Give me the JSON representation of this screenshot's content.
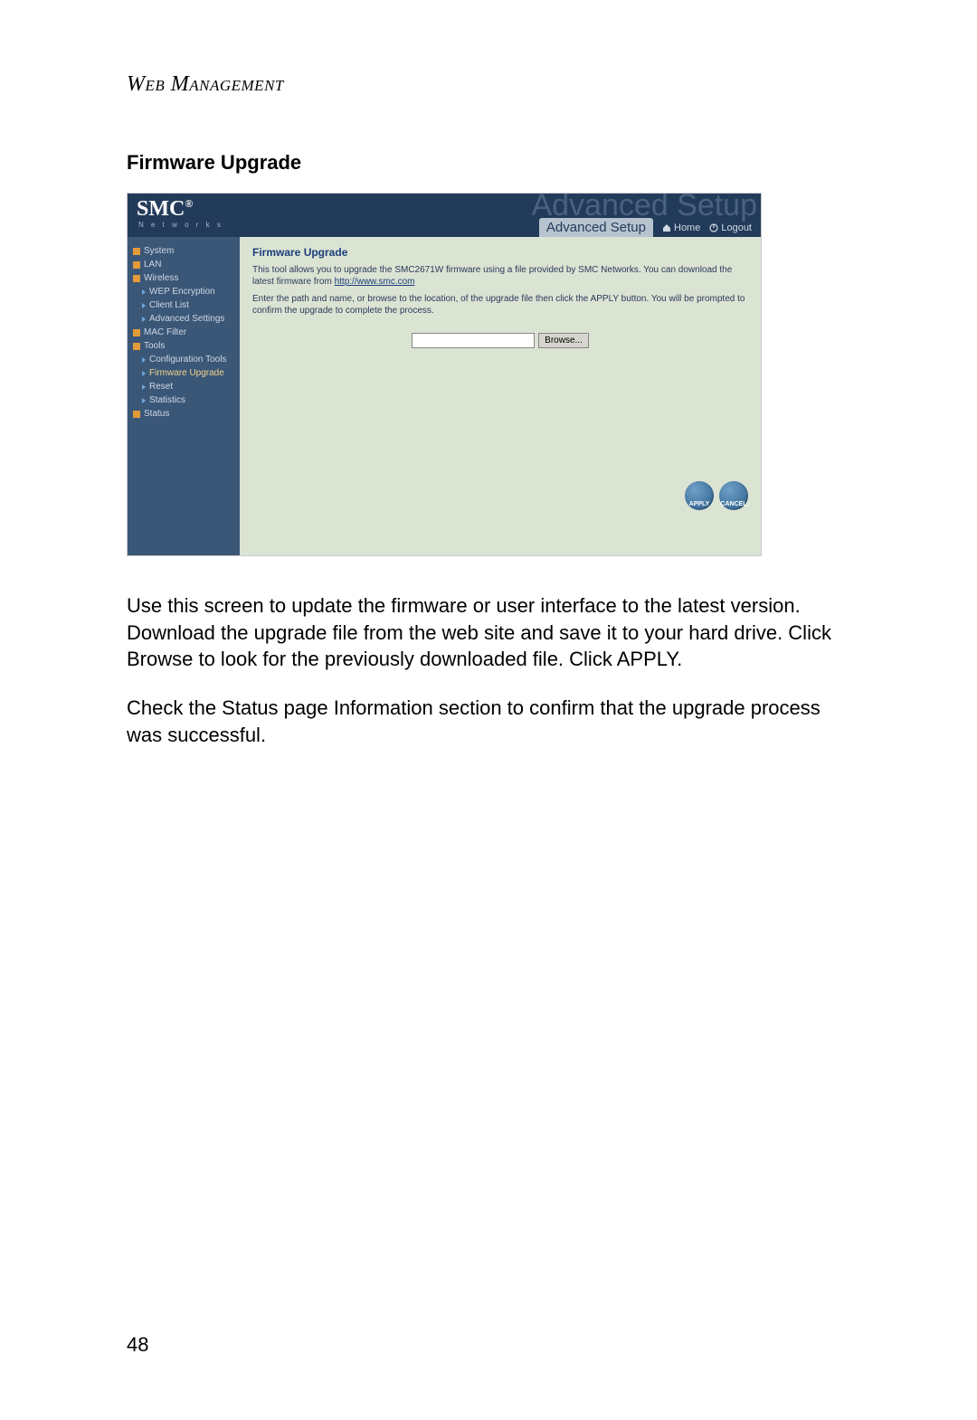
{
  "chapter_title": "Web Management",
  "section_title": "Firmware Upgrade",
  "page_number": "48",
  "paragraphs": {
    "p1": "Use this screen to update the firmware or user interface to the latest version. Download the upgrade file from the web site and save it to your hard drive. Click Browse to look for the previously downloaded file. Click APPLY.",
    "p2": "Check the Status page Information section to confirm that the upgrade process was successful."
  },
  "screenshot": {
    "logo_main": "SMC",
    "logo_reg": "®",
    "logo_sub": "N e t w o r k s",
    "ghost_title": "Advanced Setup",
    "tab_label": "Advanced Setup",
    "header_links": {
      "home": "Home",
      "logout": "Logout"
    },
    "sidebar": {
      "system": "System",
      "lan": "LAN",
      "wireless": "Wireless",
      "wep": "WEP Encryption",
      "client_list": "Client List",
      "adv_settings": "Advanced Settings",
      "mac_filter": "MAC Filter",
      "tools": "Tools",
      "config_tools": "Configuration Tools",
      "fw_upgrade": "Firmware Upgrade",
      "reset": "Reset",
      "statistics": "Statistics",
      "status": "Status"
    },
    "main": {
      "title": "Firmware Upgrade",
      "p1a": "This tool allows you to upgrade the SMC2671W firmware using a file provided by SMC Networks. You can download the latest firmware from ",
      "p1_link": "http://www.smc.com",
      "p2": "Enter the path and name, or browse to the location, of the upgrade file then click the APPLY button. You will be prompted to confirm the upgrade to complete the process.",
      "browse_label": "Browse...",
      "apply_label": "APPLY",
      "cancel_label": "CANCEL"
    }
  }
}
